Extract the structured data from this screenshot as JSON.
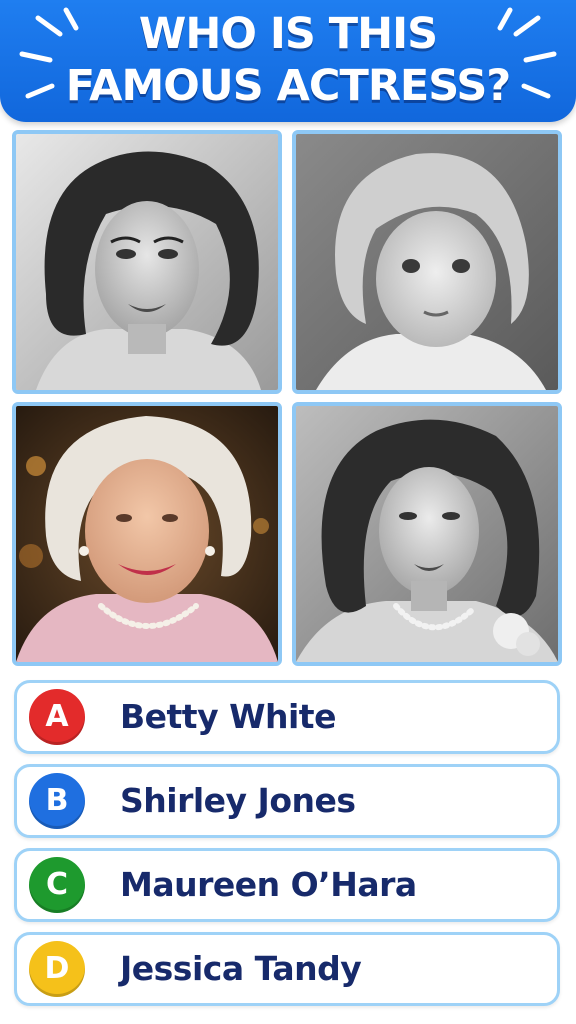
{
  "header": {
    "title_line1": "WHO IS THIS",
    "title_line2": "FAMOUS ACTRESS?",
    "color": "#1a74e8"
  },
  "photos": [
    {
      "icon": "black-and-white-portrait-young-woman"
    },
    {
      "icon": "black-and-white-portrait-child"
    },
    {
      "icon": "color-portrait-elderly-woman"
    },
    {
      "icon": "black-and-white-portrait-woman-pearls"
    }
  ],
  "options": [
    {
      "letter": "A",
      "label": "Betty White",
      "color": "#e32b2b"
    },
    {
      "letter": "B",
      "label": "Shirley Jones",
      "color": "#1f6fe0"
    },
    {
      "letter": "C",
      "label": "Maureen O’Hara",
      "color": "#1e9a2e"
    },
    {
      "letter": "D",
      "label": "Jessica Tandy",
      "color": "#f5c11a"
    }
  ]
}
